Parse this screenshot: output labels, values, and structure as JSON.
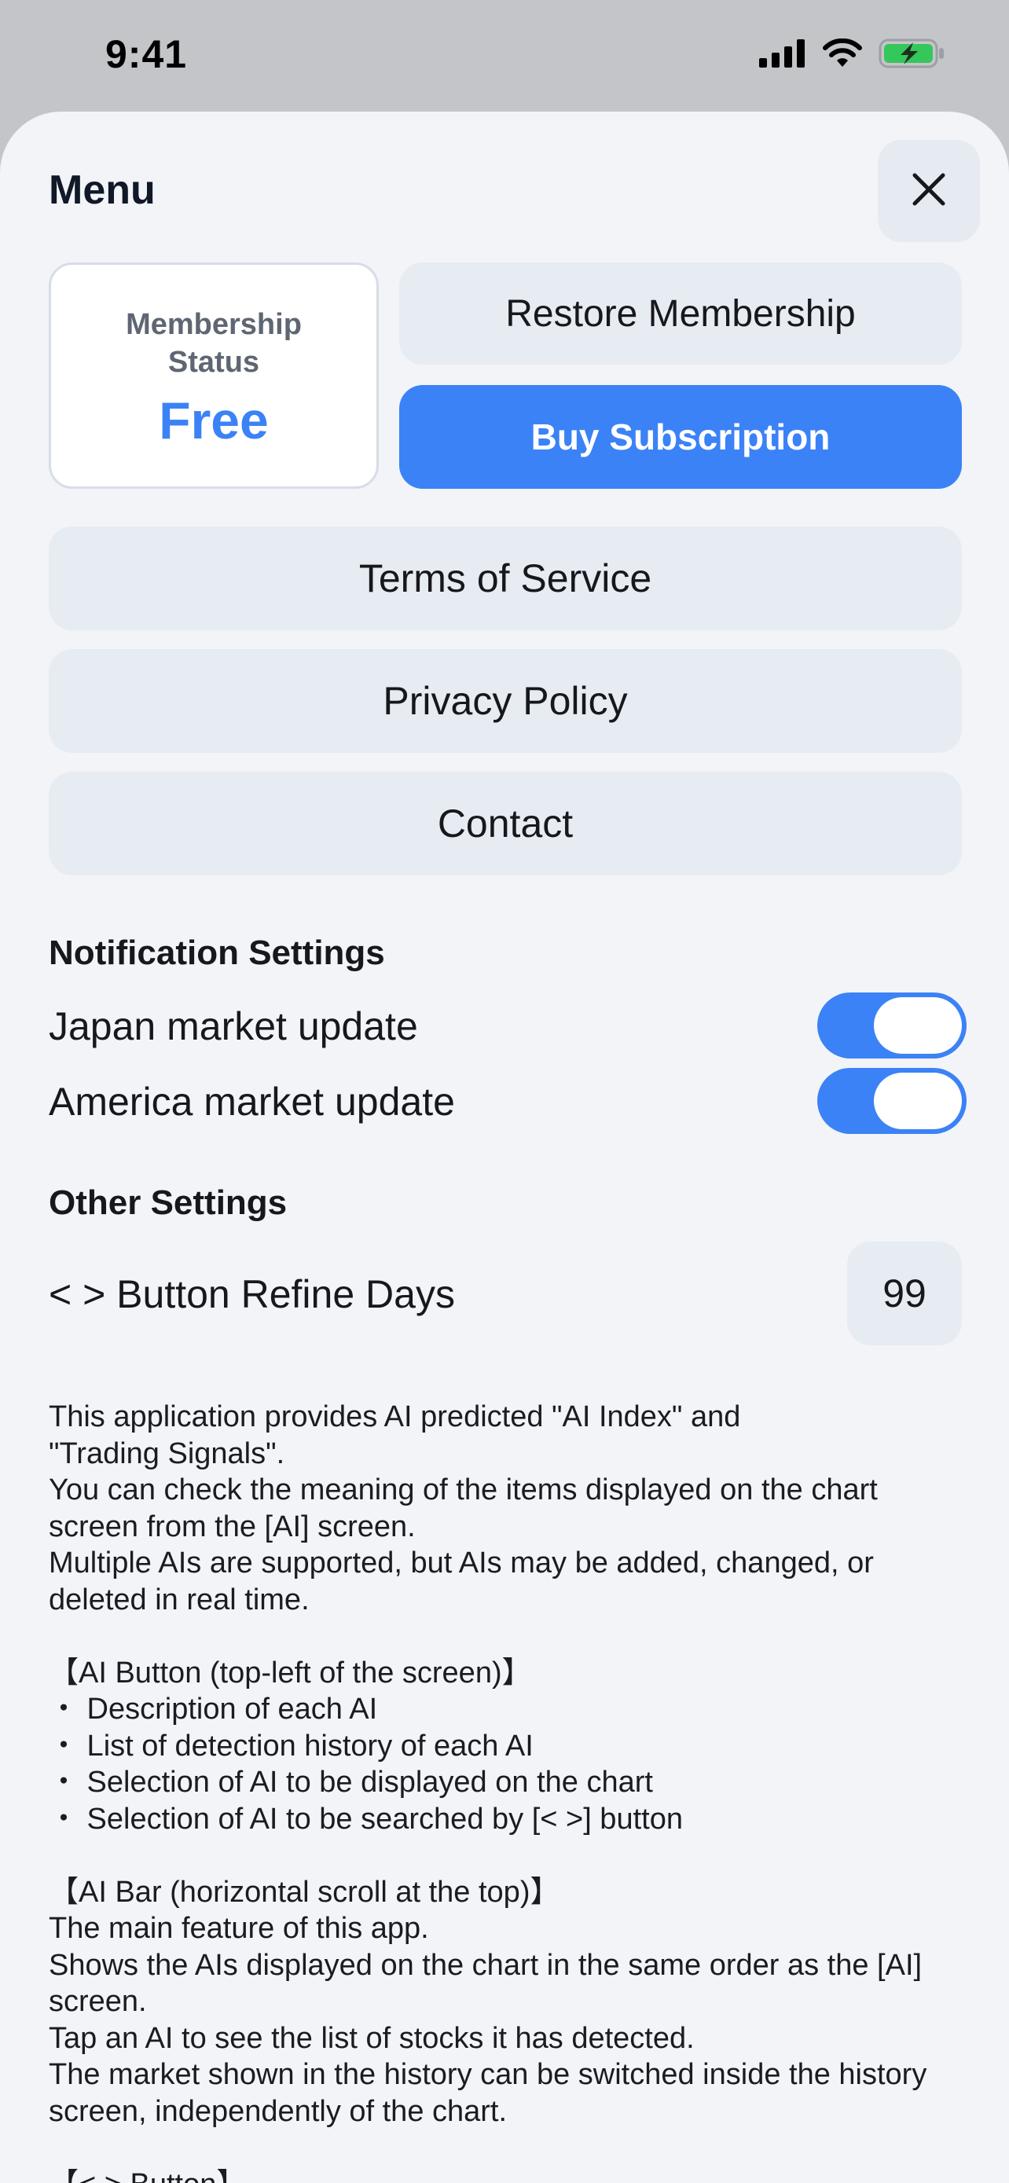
{
  "status_bar": {
    "time": "9:41",
    "icons": [
      "signal-icon",
      "wifi-icon",
      "battery-charging-icon"
    ],
    "battery_color": "#34c759"
  },
  "menu": {
    "title": "Menu",
    "close_icon": "close-icon"
  },
  "membership": {
    "label": "Membership\nStatus",
    "value": "Free",
    "value_color": "#3b82f6"
  },
  "buttons": {
    "restore": "Restore Membership",
    "buy": "Buy Subscription",
    "terms": "Terms of Service",
    "privacy": "Privacy Policy",
    "contact": "Contact"
  },
  "notification_settings": {
    "title": "Notification Settings",
    "items": [
      {
        "label": "Japan market update",
        "enabled": true
      },
      {
        "label": "America market update",
        "enabled": true
      }
    ]
  },
  "other_settings": {
    "title": "Other Settings",
    "refine_days_label": "< > Button Refine Days",
    "refine_days_value": "99"
  },
  "description": {
    "paragraphs": [
      "This application provides AI predicted \"AI Index\" and\n\"Trading Signals\".\nYou can check the meaning of the items displayed on the chart screen from the [AI] screen.\nMultiple AIs are supported, but AIs may be added, changed, or deleted in real time.",
      "【AI Button (top-left of the screen)】\n・ Description of each AI\n・ List of detection history of each AI\n・ Selection of AI to be displayed on the chart\n・ Selection of AI to be searched by [< >] button",
      "【AI Bar (horizontal scroll at the top)】\nThe main feature of this app.\nShows the AIs displayed on the chart in the same order as the [AI] screen.\nTap an AI to see the list of stocks it has detected.\nThe market shown in the history can be switched inside the history screen, independently of the chart.",
      "【< > Button】"
    ]
  },
  "colors": {
    "accent": "#3b82f6",
    "sheet_background": "#f2f4f7",
    "button_background": "#e7ebf2"
  }
}
